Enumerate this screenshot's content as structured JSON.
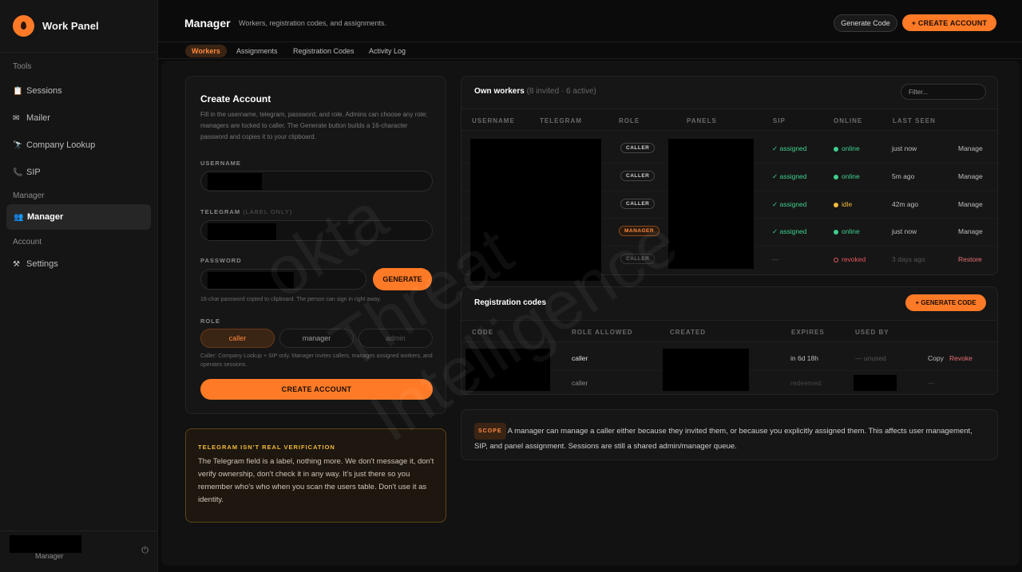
{
  "brand": {
    "name": "Work Panel"
  },
  "sidebar": {
    "sections": [
      {
        "label": "Tools",
        "items": [
          {
            "label": "Sessions",
            "icon": "clipboard-icon"
          },
          {
            "label": "Mailer",
            "icon": "mail-icon"
          },
          {
            "label": "Company Lookup",
            "icon": "telescope-icon"
          },
          {
            "label": "SIP",
            "icon": "phone-icon"
          }
        ]
      },
      {
        "label": "Manager",
        "items": [
          {
            "label": "Manager",
            "icon": "users-icon",
            "active": true
          }
        ]
      },
      {
        "label": "Account",
        "items": [
          {
            "label": "Settings",
            "icon": "tools-icon"
          }
        ]
      }
    ],
    "footer": {
      "role": "Manager"
    }
  },
  "header": {
    "title": "Manager",
    "subtitle": "Workers, registration codes, and assignments.",
    "generate_code": "Generate Code",
    "create_account": "+ CREATE ACCOUNT"
  },
  "tabs": [
    "Workers",
    "Assignments",
    "Registration Codes",
    "Activity Log"
  ],
  "create_form": {
    "title": "Create Account",
    "description": "Fill in the username, telegram, password, and role. Admins can choose any role; managers are locked to caller. The Generate button builds a 16-character password and copies it to your clipboard.",
    "username_label": "USERNAME",
    "telegram_label": "TELEGRAM",
    "telegram_note": "(LABEL ONLY)",
    "password_label": "PASSWORD",
    "generate": "GENERATE",
    "password_hint": "16-char password copied to clipboard. The person can sign in right away.",
    "role_label": "ROLE",
    "roles": [
      "caller",
      "manager",
      "admin"
    ],
    "role_hint": "Caller: Company Lookup + SIP only. Manager invites callers, manages assigned workers, and operates sessions.",
    "submit": "CREATE ACCOUNT"
  },
  "warning": {
    "title": "TELEGRAM ISN'T REAL VERIFICATION",
    "body": "The Telegram field is a label, nothing more. We don't message it, don't verify ownership, don't check it in any way. It's just there so you remember who's who when you scan the users table. Don't use it as identity."
  },
  "workers": {
    "title": "Own workers",
    "summary": "(8 invited · 6 active)",
    "filter_placeholder": "Filter...",
    "columns": [
      "USERNAME",
      "TELEGRAM",
      "ROLE",
      "PANELS",
      "SIP",
      "ONLINE",
      "LAST SEEN"
    ],
    "rows": [
      {
        "role": "CALLER",
        "sip": "✓ assigned",
        "online": "online",
        "last_seen": "just now",
        "action": "Manage"
      },
      {
        "role": "CALLER",
        "sip": "✓ assigned",
        "online": "online",
        "last_seen": "5m ago",
        "action": "Manage"
      },
      {
        "role": "CALLER",
        "sip": "✓ assigned",
        "online": "idle",
        "last_seen": "42m ago",
        "action": "Manage"
      },
      {
        "role": "MANAGER",
        "sip": "✓ assigned",
        "online": "online",
        "last_seen": "just now",
        "action": "Manage"
      },
      {
        "role": "CALLER",
        "sip": "—",
        "online": "revoked",
        "last_seen": "3 days ago",
        "action": "Restore"
      }
    ]
  },
  "codes": {
    "title": "Registration codes",
    "generate": "+ GENERATE CODE",
    "columns": [
      "CODE",
      "ROLE ALLOWED",
      "CREATED",
      "EXPIRES",
      "USED BY"
    ],
    "rows": [
      {
        "role": "caller",
        "expires": "in 6d 18h",
        "used_by": "— unused",
        "copy": "Copy",
        "revoke": "Revoke"
      },
      {
        "role": "caller",
        "expires": "redeemed",
        "used_by": "",
        "trailing": "—"
      }
    ]
  },
  "scope": {
    "badge": "SCOPE",
    "text": "A manager can manage a caller either because they invited them, or because you explicitly assigned them. This affects user management, SIP, and panel assignment. Sessions are still a shared admin/manager queue."
  },
  "watermark": {
    "line1": "okta",
    "line2": "Threat",
    "line3": "Intelligence"
  },
  "colors": {
    "accent": "#ff7a26",
    "online": "#3ecf8e",
    "idle": "#f2b93b",
    "revoked": "#e8585f"
  }
}
